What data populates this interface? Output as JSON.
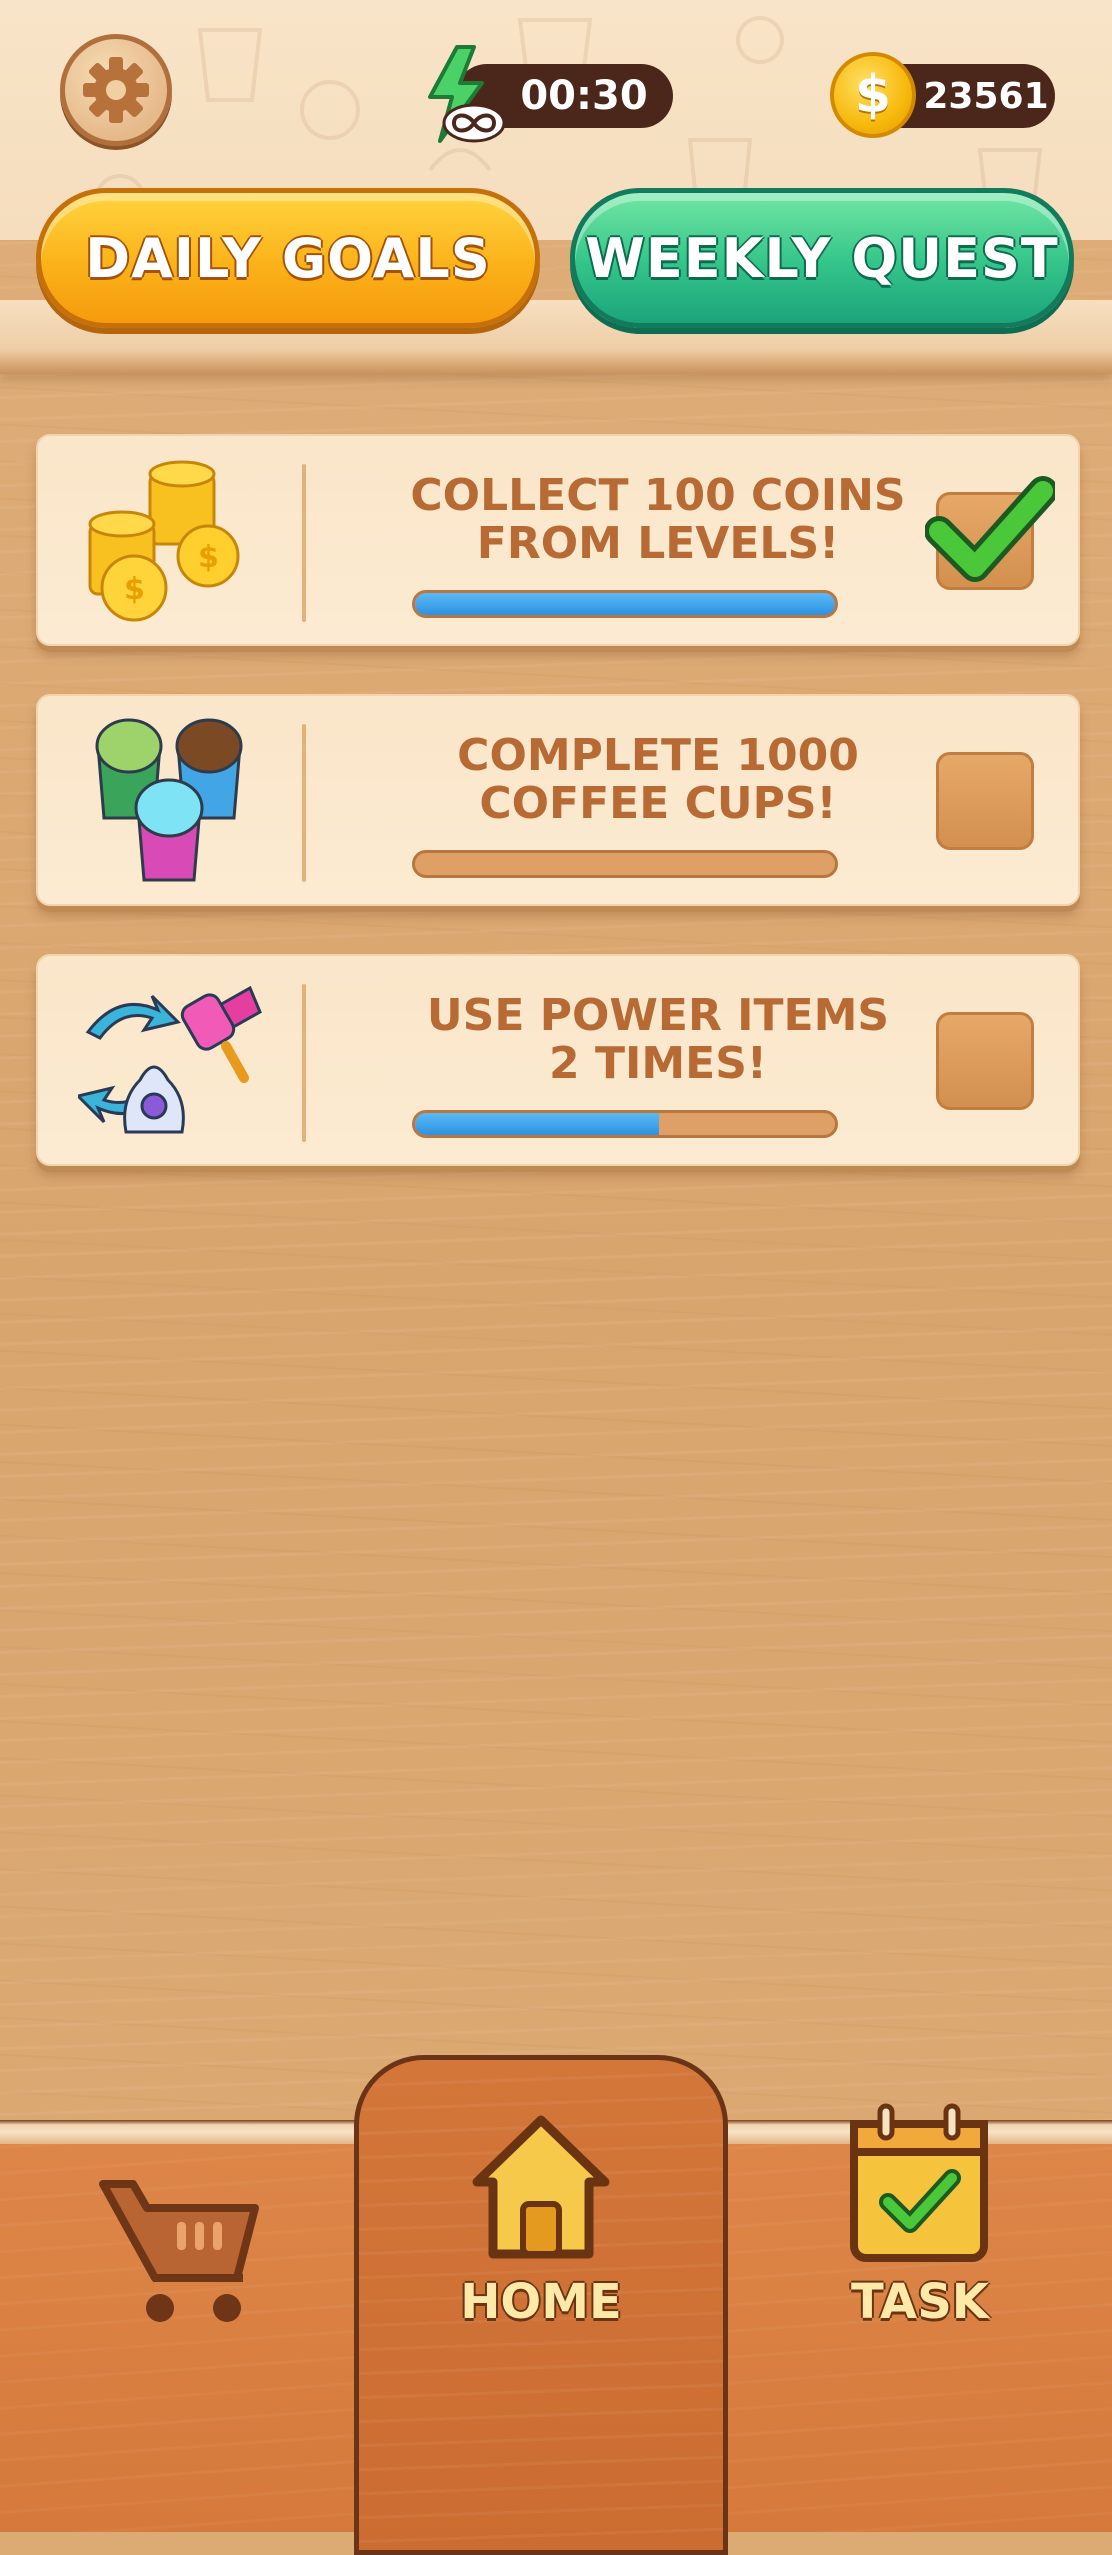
{
  "header": {
    "timer": "00:30",
    "coins": "23561",
    "coin_symbol": "$"
  },
  "tabs": [
    {
      "label": "DAILY GOALS"
    },
    {
      "label": "WEEKLY QUEST"
    }
  ],
  "goals": [
    {
      "icon": "coin-stack-icon",
      "line1": "COLLECT 100 COINS",
      "line2": "FROM LEVELS!",
      "progress": 1.0,
      "completed": true
    },
    {
      "icon": "coffee-cups-icon",
      "line1": "COMPLETE 1000",
      "line2": "COFFEE CUPS!",
      "progress": 0.0,
      "completed": false
    },
    {
      "icon": "power-items-icon",
      "line1": "USE POWER ITEMS",
      "line2": "2 TIMES!",
      "progress": 0.58,
      "completed": false
    }
  ],
  "nav": {
    "shop_icon": "cart-icon",
    "home_label": "HOME",
    "task_label": "TASK"
  },
  "colors": {
    "progress_fill": "#2e92e2",
    "daily_tab": "#fbb21a",
    "weekly_tab": "#33c48a",
    "checkmark": "#4ac83a"
  }
}
